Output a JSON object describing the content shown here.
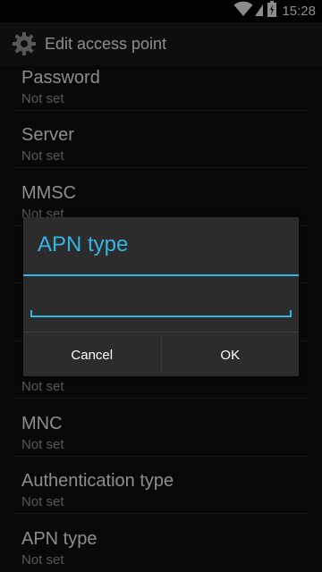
{
  "status_bar": {
    "time": "15:28"
  },
  "action_bar": {
    "title": "Edit access point"
  },
  "list": {
    "items": [
      {
        "title": "Password",
        "summary": "Not set"
      },
      {
        "title": "Server",
        "summary": "Not set"
      },
      {
        "title": "MMSC",
        "summary": "Not set"
      },
      {
        "title": "",
        "summary": ""
      },
      {
        "title": "",
        "summary": ""
      },
      {
        "title": "",
        "summary": "Not set"
      },
      {
        "title": "MNC",
        "summary": "Not set"
      },
      {
        "title": "Authentication type",
        "summary": "Not set"
      },
      {
        "title": "APN type",
        "summary": "Not set"
      }
    ]
  },
  "dialog": {
    "title": "APN type",
    "input_value": "",
    "cancel_label": "Cancel",
    "ok_label": "OK"
  },
  "colors": {
    "accent": "#33b5e5"
  }
}
